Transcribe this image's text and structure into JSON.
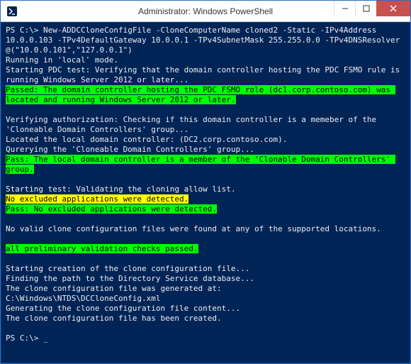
{
  "window": {
    "title": "Administrator: Windows PowerShell"
  },
  "prompt": "PS C:\\>",
  "command": {
    "cmdlet": "New-ADDCCloneConfigFile",
    "line": "-CloneComputerName cloned2 -Static -IPv4Address 10.0.0.103 -TPv4DefaultGateway 10.0.0.1 -TPv4SubnetMask 255.255.0.0 -TPv4DNSResolver @(\"10.0.0.101\",\"127.0.0.1\")"
  },
  "output": {
    "running_mode": "Running in 'local' mode.",
    "pdc_test_start": "Starting PDC test: Verifying that the domain controller hosting the PDC FSMO rule is running Windows Server 2012 or later...",
    "pdc_pass": "Passed: The domain controller hosting the PDC FSMO role (dc1.corp.contoso.com) was located and running Windows Server 2012 or later.",
    "verify_auth": "Verifying authorization: Checking if this domain controller is a memeber of the 'Cloneable Domain Controllers' group...",
    "located_local": "Located the local domain controller: (DC2.corp.contoso.com).",
    "querying": "Qurerying the 'Cloneable Domain Controllers' group...",
    "auth_pass": "Pass: The local domain controller is a member of the 'Clonable Domain Controllers' group.",
    "allow_list_start": "Starting test: Validating the cloning allow list.",
    "no_excluded": "No excluded applications were detected.",
    "allow_pass": "Pass: No excluded applications were detected.",
    "no_valid": "No valid clone configuration files were found at any of the supported locations.",
    "prelim_pass": "all preliminary validation checks passed.",
    "creating": "Starting creation of the clone configuration file...",
    "finding_path": "Finding the path to the Directory Service database...",
    "generated_at": "The clone configuration file was generated at:",
    "path": "C:\\Windows\\NTDS\\DCCloneConfig.xml",
    "gen_content": "Generating the clone configuration file content...",
    "created": "The clone configuration file has been created."
  }
}
